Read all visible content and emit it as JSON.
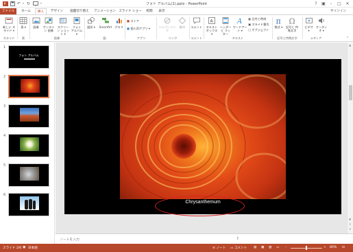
{
  "window": {
    "title": "フォト アルバム(1).pptx - PowerPoint",
    "signin": "サインイン"
  },
  "tabs": [
    {
      "label": "ファイル"
    },
    {
      "label": "ホーム"
    },
    {
      "label": "挿入"
    },
    {
      "label": "デザイン"
    },
    {
      "label": "画面切り替え"
    },
    {
      "label": "アニメーション"
    },
    {
      "label": "スライド ショー"
    },
    {
      "label": "校閲"
    },
    {
      "label": "表示"
    }
  ],
  "ribbon": {
    "new_slide": "新しい スライド ▾",
    "table": "表 ▾",
    "image": "画像",
    "online_image": "オンライン 画像",
    "screenshot": "スクリーン ショット ▾",
    "photo_album": "フォト アルバム ▾",
    "shapes": "図形 ▾",
    "smartart": "SmartArt",
    "chart": "グラフ",
    "store": "ストア",
    "my_apps": "個人用アプリ ▾",
    "hyperlink": "ハイパーリンク",
    "action": "動作",
    "comment": "コメント",
    "textbox": "テキスト ボックス ▾",
    "header_footer": "ヘッダーと フッター",
    "wordart": "ワードアート ▾",
    "date_time": "日付と時刻",
    "slide_number": "スライド番号",
    "object": "オブジェクト",
    "equation": "数式 ▾",
    "symbol": "記号と 特殊文字",
    "video": "ビデオ ▾",
    "audio": "オーディオ ▾",
    "groups": {
      "slides": "スライド",
      "tables": "表",
      "images": "画像",
      "illustrations": "図",
      "apps": "アプリ",
      "links": "リンク",
      "comments": "コメント",
      "text": "テキスト",
      "symbols": "記号と特殊文字",
      "media": "メディア"
    }
  },
  "thumbnails": [
    {
      "num": "1",
      "title": "フォト アルバム"
    },
    {
      "num": "2"
    },
    {
      "num": "3"
    },
    {
      "num": "4"
    },
    {
      "num": "5"
    },
    {
      "num": "6"
    }
  ],
  "slide": {
    "caption": "Chrysanthemum"
  },
  "notes": {
    "placeholder": "ノートを入力"
  },
  "status": {
    "slide_info": "スライド 2/6",
    "language": "日本語",
    "notes_btn": "ノート",
    "comments_btn": "コメント",
    "zoom": "80%"
  },
  "colors": {
    "accent": "#b7472a",
    "highlight_circle": "#d9231f"
  }
}
